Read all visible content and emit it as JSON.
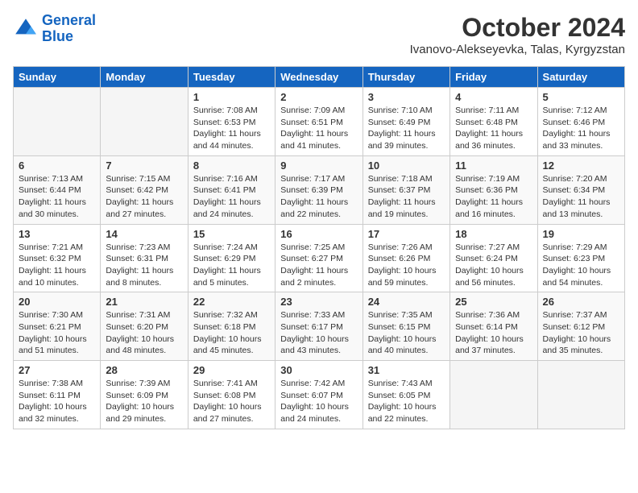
{
  "header": {
    "logo_line1": "General",
    "logo_line2": "Blue",
    "month": "October 2024",
    "location": "Ivanovo-Alekseyevka, Talas, Kyrgyzstan"
  },
  "days_of_week": [
    "Sunday",
    "Monday",
    "Tuesday",
    "Wednesday",
    "Thursday",
    "Friday",
    "Saturday"
  ],
  "weeks": [
    [
      {
        "num": "",
        "sunrise": "",
        "sunset": "",
        "daylight": ""
      },
      {
        "num": "",
        "sunrise": "",
        "sunset": "",
        "daylight": ""
      },
      {
        "num": "1",
        "sunrise": "Sunrise: 7:08 AM",
        "sunset": "Sunset: 6:53 PM",
        "daylight": "Daylight: 11 hours and 44 minutes."
      },
      {
        "num": "2",
        "sunrise": "Sunrise: 7:09 AM",
        "sunset": "Sunset: 6:51 PM",
        "daylight": "Daylight: 11 hours and 41 minutes."
      },
      {
        "num": "3",
        "sunrise": "Sunrise: 7:10 AM",
        "sunset": "Sunset: 6:49 PM",
        "daylight": "Daylight: 11 hours and 39 minutes."
      },
      {
        "num": "4",
        "sunrise": "Sunrise: 7:11 AM",
        "sunset": "Sunset: 6:48 PM",
        "daylight": "Daylight: 11 hours and 36 minutes."
      },
      {
        "num": "5",
        "sunrise": "Sunrise: 7:12 AM",
        "sunset": "Sunset: 6:46 PM",
        "daylight": "Daylight: 11 hours and 33 minutes."
      }
    ],
    [
      {
        "num": "6",
        "sunrise": "Sunrise: 7:13 AM",
        "sunset": "Sunset: 6:44 PM",
        "daylight": "Daylight: 11 hours and 30 minutes."
      },
      {
        "num": "7",
        "sunrise": "Sunrise: 7:15 AM",
        "sunset": "Sunset: 6:42 PM",
        "daylight": "Daylight: 11 hours and 27 minutes."
      },
      {
        "num": "8",
        "sunrise": "Sunrise: 7:16 AM",
        "sunset": "Sunset: 6:41 PM",
        "daylight": "Daylight: 11 hours and 24 minutes."
      },
      {
        "num": "9",
        "sunrise": "Sunrise: 7:17 AM",
        "sunset": "Sunset: 6:39 PM",
        "daylight": "Daylight: 11 hours and 22 minutes."
      },
      {
        "num": "10",
        "sunrise": "Sunrise: 7:18 AM",
        "sunset": "Sunset: 6:37 PM",
        "daylight": "Daylight: 11 hours and 19 minutes."
      },
      {
        "num": "11",
        "sunrise": "Sunrise: 7:19 AM",
        "sunset": "Sunset: 6:36 PM",
        "daylight": "Daylight: 11 hours and 16 minutes."
      },
      {
        "num": "12",
        "sunrise": "Sunrise: 7:20 AM",
        "sunset": "Sunset: 6:34 PM",
        "daylight": "Daylight: 11 hours and 13 minutes."
      }
    ],
    [
      {
        "num": "13",
        "sunrise": "Sunrise: 7:21 AM",
        "sunset": "Sunset: 6:32 PM",
        "daylight": "Daylight: 11 hours and 10 minutes."
      },
      {
        "num": "14",
        "sunrise": "Sunrise: 7:23 AM",
        "sunset": "Sunset: 6:31 PM",
        "daylight": "Daylight: 11 hours and 8 minutes."
      },
      {
        "num": "15",
        "sunrise": "Sunrise: 7:24 AM",
        "sunset": "Sunset: 6:29 PM",
        "daylight": "Daylight: 11 hours and 5 minutes."
      },
      {
        "num": "16",
        "sunrise": "Sunrise: 7:25 AM",
        "sunset": "Sunset: 6:27 PM",
        "daylight": "Daylight: 11 hours and 2 minutes."
      },
      {
        "num": "17",
        "sunrise": "Sunrise: 7:26 AM",
        "sunset": "Sunset: 6:26 PM",
        "daylight": "Daylight: 10 hours and 59 minutes."
      },
      {
        "num": "18",
        "sunrise": "Sunrise: 7:27 AM",
        "sunset": "Sunset: 6:24 PM",
        "daylight": "Daylight: 10 hours and 56 minutes."
      },
      {
        "num": "19",
        "sunrise": "Sunrise: 7:29 AM",
        "sunset": "Sunset: 6:23 PM",
        "daylight": "Daylight: 10 hours and 54 minutes."
      }
    ],
    [
      {
        "num": "20",
        "sunrise": "Sunrise: 7:30 AM",
        "sunset": "Sunset: 6:21 PM",
        "daylight": "Daylight: 10 hours and 51 minutes."
      },
      {
        "num": "21",
        "sunrise": "Sunrise: 7:31 AM",
        "sunset": "Sunset: 6:20 PM",
        "daylight": "Daylight: 10 hours and 48 minutes."
      },
      {
        "num": "22",
        "sunrise": "Sunrise: 7:32 AM",
        "sunset": "Sunset: 6:18 PM",
        "daylight": "Daylight: 10 hours and 45 minutes."
      },
      {
        "num": "23",
        "sunrise": "Sunrise: 7:33 AM",
        "sunset": "Sunset: 6:17 PM",
        "daylight": "Daylight: 10 hours and 43 minutes."
      },
      {
        "num": "24",
        "sunrise": "Sunrise: 7:35 AM",
        "sunset": "Sunset: 6:15 PM",
        "daylight": "Daylight: 10 hours and 40 minutes."
      },
      {
        "num": "25",
        "sunrise": "Sunrise: 7:36 AM",
        "sunset": "Sunset: 6:14 PM",
        "daylight": "Daylight: 10 hours and 37 minutes."
      },
      {
        "num": "26",
        "sunrise": "Sunrise: 7:37 AM",
        "sunset": "Sunset: 6:12 PM",
        "daylight": "Daylight: 10 hours and 35 minutes."
      }
    ],
    [
      {
        "num": "27",
        "sunrise": "Sunrise: 7:38 AM",
        "sunset": "Sunset: 6:11 PM",
        "daylight": "Daylight: 10 hours and 32 minutes."
      },
      {
        "num": "28",
        "sunrise": "Sunrise: 7:39 AM",
        "sunset": "Sunset: 6:09 PM",
        "daylight": "Daylight: 10 hours and 29 minutes."
      },
      {
        "num": "29",
        "sunrise": "Sunrise: 7:41 AM",
        "sunset": "Sunset: 6:08 PM",
        "daylight": "Daylight: 10 hours and 27 minutes."
      },
      {
        "num": "30",
        "sunrise": "Sunrise: 7:42 AM",
        "sunset": "Sunset: 6:07 PM",
        "daylight": "Daylight: 10 hours and 24 minutes."
      },
      {
        "num": "31",
        "sunrise": "Sunrise: 7:43 AM",
        "sunset": "Sunset: 6:05 PM",
        "daylight": "Daylight: 10 hours and 22 minutes."
      },
      {
        "num": "",
        "sunrise": "",
        "sunset": "",
        "daylight": ""
      },
      {
        "num": "",
        "sunrise": "",
        "sunset": "",
        "daylight": ""
      }
    ]
  ]
}
